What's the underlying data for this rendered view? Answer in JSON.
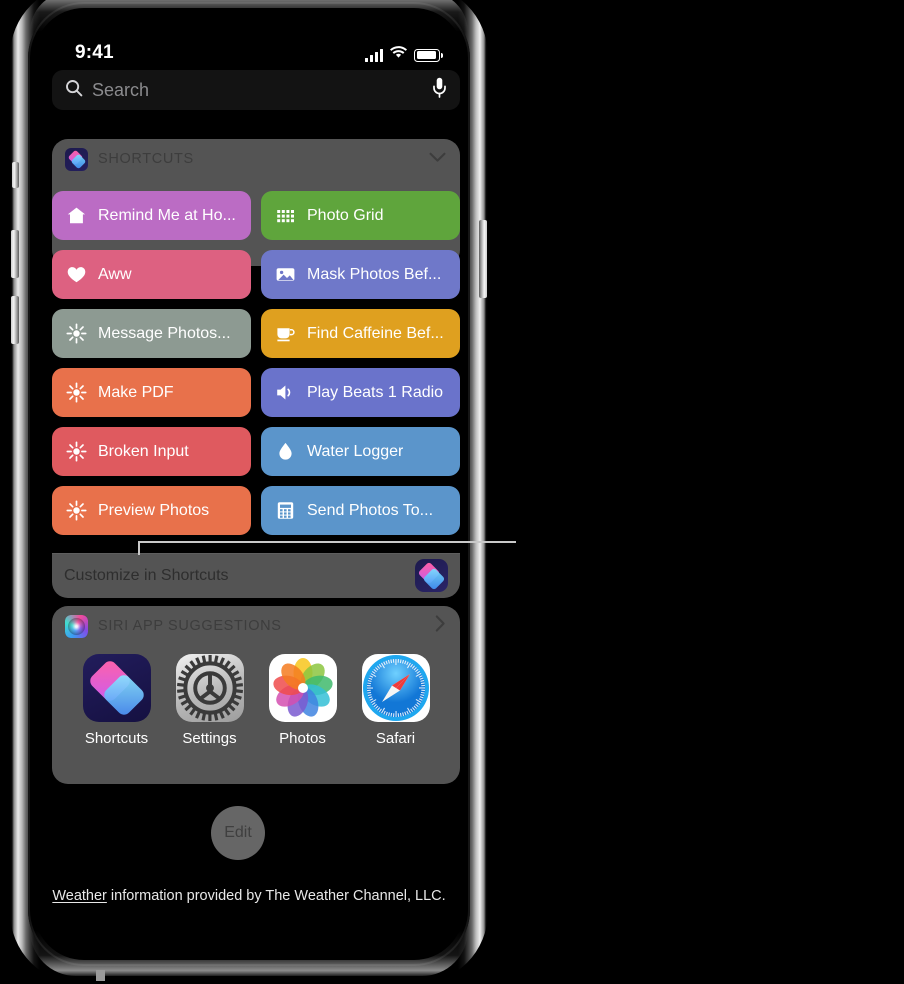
{
  "statusbar": {
    "time": "9:41",
    "cellular_icon": "signal-bars-icon",
    "wifi_icon": "wifi-icon",
    "battery_icon": "battery-icon"
  },
  "search": {
    "placeholder": "Search",
    "value": "",
    "search_icon": "search-icon",
    "dictation_icon": "microphone-icon"
  },
  "shortcuts_widget": {
    "title": "SHORTCUTS",
    "app_icon": "shortcuts-app-icon",
    "collapse_icon": "chevron-down-icon",
    "tiles": [
      {
        "label": "Remind Me at Ho...",
        "icon": "house-icon",
        "color": "#bb6cc4"
      },
      {
        "label": "Photo Grid",
        "icon": "dot-grid-icon",
        "color": "#5fa53c"
      },
      {
        "label": "Aww",
        "icon": "heart-icon",
        "color": "#dd6181"
      },
      {
        "label": "Mask Photos Bef...",
        "icon": "photo-icon",
        "color": "#6f78c9"
      },
      {
        "label": "Message Photos...",
        "icon": "sparkle-icon",
        "color": "#8d9a92"
      },
      {
        "label": "Find Caffeine Bef...",
        "icon": "coffee-cup-icon",
        "color": "#dfa01f"
      },
      {
        "label": "Make PDF",
        "icon": "sparkle-icon",
        "color": "#e8714b"
      },
      {
        "label": "Play Beats 1 Radio",
        "icon": "speaker-icon",
        "color": "#6a73cb"
      },
      {
        "label": "Broken Input",
        "icon": "sparkle-icon",
        "color": "#df5a5f"
      },
      {
        "label": "Water Logger",
        "icon": "water-drop-icon",
        "color": "#5b95cb"
      },
      {
        "label": "Preview Photos",
        "icon": "sparkle-icon",
        "color": "#e8714b"
      },
      {
        "label": "Send Photos To...",
        "icon": "calculator-icon",
        "color": "#5b95cb"
      }
    ],
    "footer_label": "Customize in Shortcuts",
    "footer_app_icon": "shortcuts-app-icon"
  },
  "siri_widget": {
    "title": "SIRI APP SUGGESTIONS",
    "app_icon": "siri-icon",
    "disclosure_icon": "chevron-right-icon",
    "apps": [
      {
        "name": "Shortcuts",
        "icon": "shortcuts-app-icon"
      },
      {
        "name": "Settings",
        "icon": "settings-app-icon"
      },
      {
        "name": "Photos",
        "icon": "photos-app-icon"
      },
      {
        "name": "Safari",
        "icon": "safari-app-icon"
      }
    ]
  },
  "edit_button": {
    "label": "Edit"
  },
  "footer": {
    "link_text": "Weather",
    "rest_text": " information provided by The Weather Channel, LLC."
  },
  "colors": {
    "widget_background": "#878787",
    "screen_background": "#000000",
    "search_background": "#131313"
  }
}
